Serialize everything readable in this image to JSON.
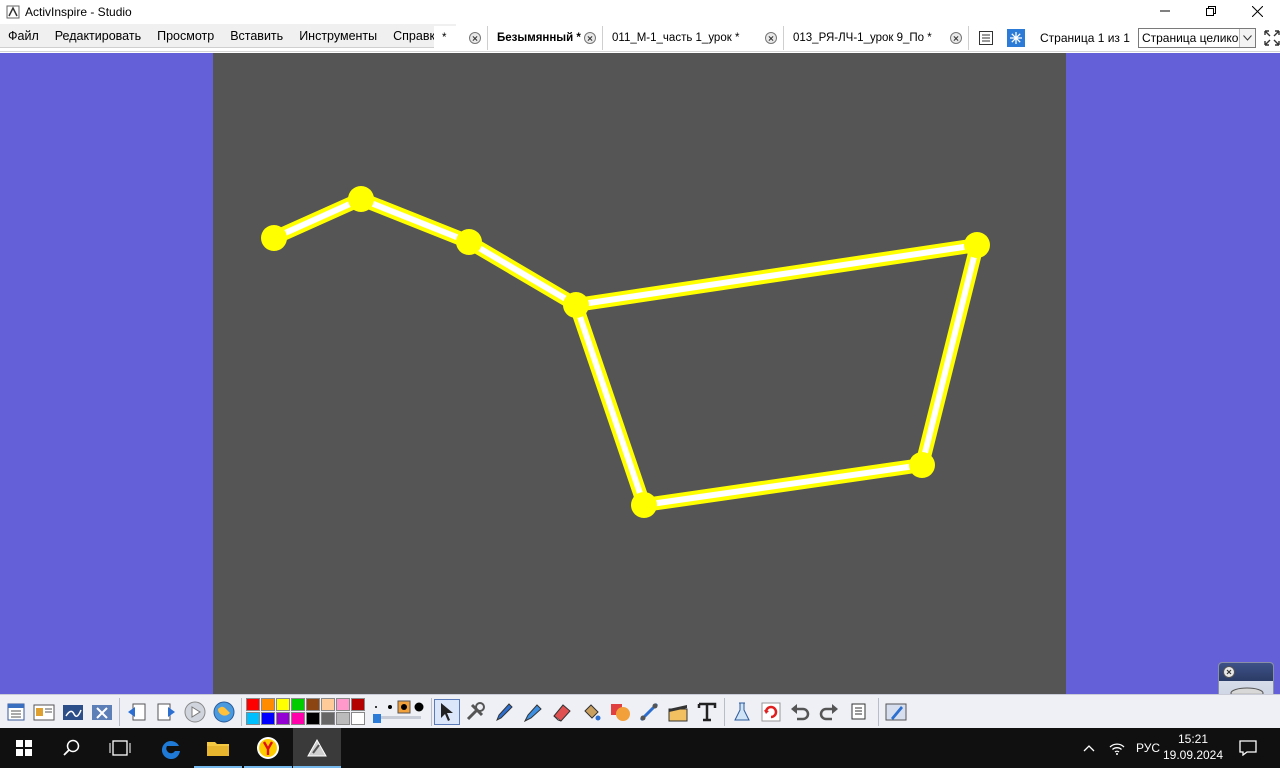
{
  "window": {
    "title": "ActivInspire - Studio"
  },
  "menu": {
    "items": [
      "Файл",
      "Редактировать",
      "Просмотр",
      "Вставить",
      "Инструменты",
      "Справка"
    ]
  },
  "tabs": [
    {
      "label": "*",
      "active": false
    },
    {
      "label": "Безымянный *",
      "active": true
    },
    {
      "label": "011_М-1_часть 1_урок  *",
      "active": false
    },
    {
      "label": "013_РЯ-ЛЧ-1_урок 9_По *",
      "active": false
    }
  ],
  "page_nav": {
    "info": "Страница 1 из 1",
    "zoom_value": "Страница целиком"
  },
  "flipchart": {
    "background": "#555555",
    "workspace_background": "#6460d8",
    "star_color": "#ffff00",
    "line_color": "#ffffff"
  },
  "palette": {
    "row1": [
      "#ff0000",
      "#ff8c00",
      "#ffff00",
      "#00cc00",
      "#8b4513",
      "#ffcc99",
      "#ff99cc",
      "#b30000"
    ],
    "row2": [
      "#00bfff",
      "#0000ff",
      "#9400d3",
      "#ff00aa",
      "#000000",
      "#666666",
      "#bbbbbb",
      "#ffffff"
    ]
  },
  "taskbar": {
    "language": "РУС",
    "time": "15:21",
    "date": "19.09.2024"
  }
}
